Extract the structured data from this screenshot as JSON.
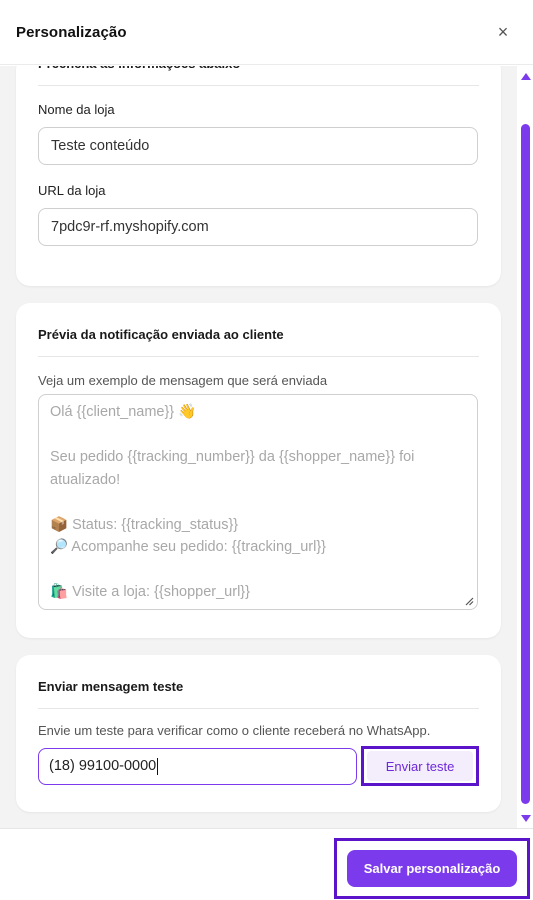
{
  "header": {
    "title": "Personalização",
    "close_symbol": "×"
  },
  "store_card": {
    "title": "Preencha as informações abaixo",
    "name_label": "Nome da loja",
    "name_value": "Teste conteúdo",
    "url_label": "URL da loja",
    "url_value": "7pdc9r-rf.myshopify.com"
  },
  "preview_card": {
    "title": "Prévia da notificação enviada ao cliente",
    "hint": "Veja um exemplo de mensagem que será enviada",
    "lines": [
      "Olá {{client_name}} 👋",
      "",
      "Seu pedido {{tracking_number}} da {{shopper_name}} foi",
      "atualizado!",
      "",
      "📦 Status: {{tracking_status}}",
      "🔎 Acompanhe seu pedido: {{tracking_url}}",
      "",
      "🛍️ Visite a loja: {{shopper_url}}"
    ]
  },
  "test_card": {
    "title": "Enviar mensagem teste",
    "hint": "Envie um teste para verificar como o cliente receberá no WhatsApp.",
    "phone_value": "(18) 99100-0000",
    "send_label": "Enviar teste"
  },
  "footer": {
    "save_label": "Salvar personalização"
  },
  "colors": {
    "accent": "#7c3aed",
    "highlight_border": "#5b14c9",
    "page_bg": "#f3f3f3"
  }
}
